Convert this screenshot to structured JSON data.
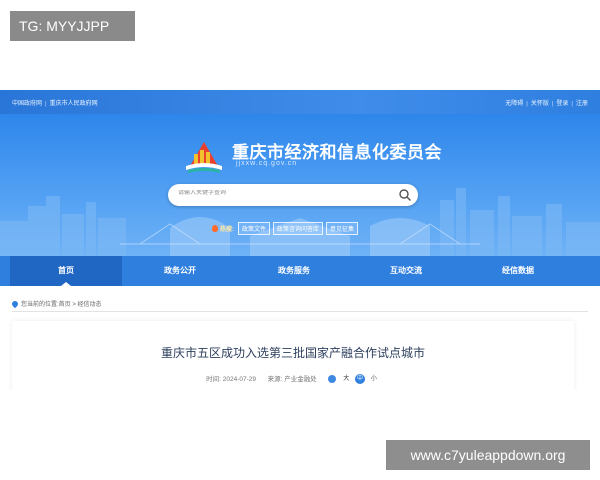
{
  "overlay": {
    "tg_label": "TG: MYYJJPP",
    "watermark": "www.c7yuleappdown.org"
  },
  "topbar": {
    "left_links": [
      "中国政府网",
      "重庆市人民政府网"
    ],
    "right_links": [
      "无障碍",
      "关怀版",
      "登录",
      "注册"
    ]
  },
  "header": {
    "title": "重庆市经济和信息化委员会",
    "url": "jjxxw.cq.gov.cn"
  },
  "search": {
    "placeholder": "请输入关键字查询",
    "icon": "search-icon"
  },
  "hot": {
    "label": "热搜:",
    "tags": [
      "政策文件",
      "政策咨询问答库",
      "意见征集"
    ]
  },
  "nav": {
    "items": [
      "首页",
      "政务公开",
      "政务服务",
      "互动交流",
      "经信数据"
    ],
    "active_index": 0
  },
  "breadcrumb": {
    "prefix": "您当前的位置:",
    "path": "首页 > 经信动态"
  },
  "article": {
    "title": "重庆市五区成功入选第三批国家产融合作试点城市",
    "time_label": "时间:",
    "time": "2024-07-29",
    "source_label": "来源:",
    "source": "产业金融处",
    "font_large": "大",
    "font_medium": "中",
    "font_small": "小"
  },
  "colors": {
    "primary_blue": "#2f7fde",
    "nav_active": "#2067c4",
    "title_text": "#2d3f5e"
  }
}
